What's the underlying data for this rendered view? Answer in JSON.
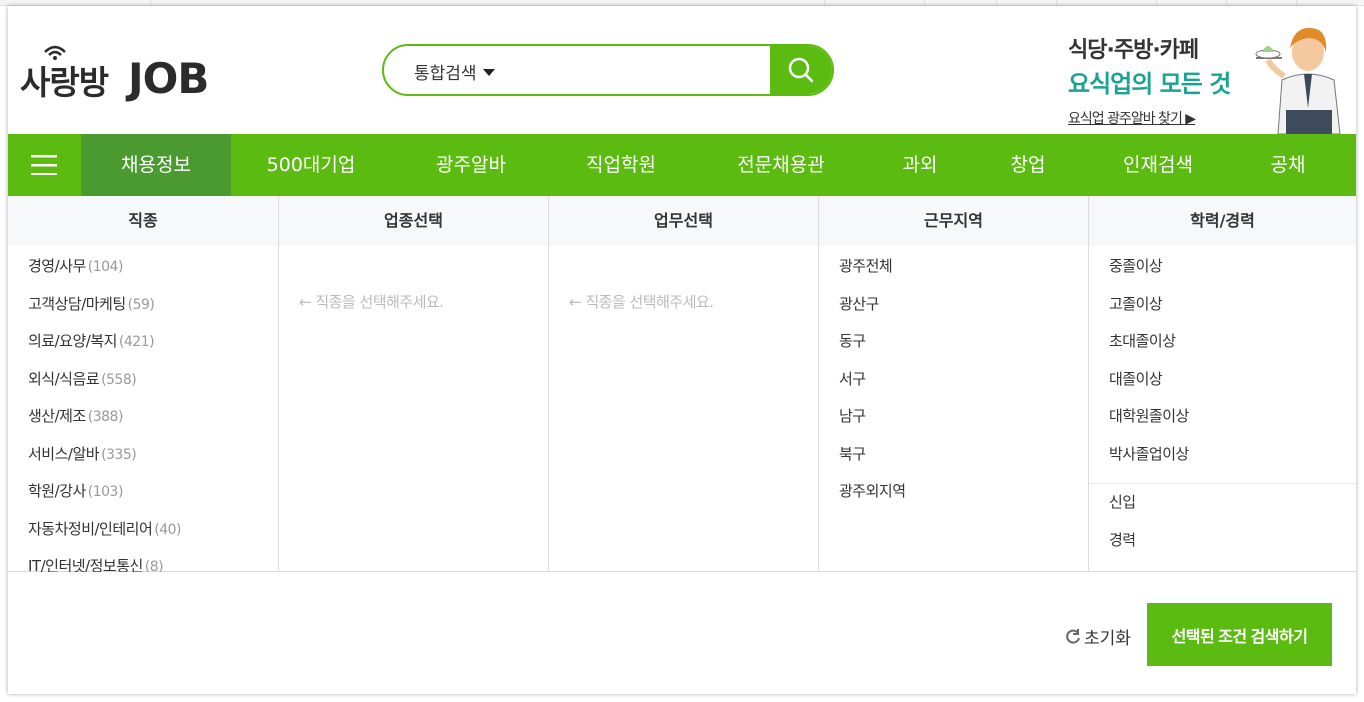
{
  "logo": {
    "text_green": "사랑방",
    "text_dark": "JOB"
  },
  "search": {
    "select_label": "통합검색",
    "placeholder": "",
    "value": ""
  },
  "banner": {
    "line1": "식당·주방·카페",
    "line2": "요식업의 모든 것",
    "line3": "요식업 광주알바 찾기 ▶"
  },
  "nav": {
    "items": [
      {
        "label": "채용정보"
      },
      {
        "label": "500대기업"
      },
      {
        "label": "광주알바"
      },
      {
        "label": "직업학원"
      },
      {
        "label": "전문채용관"
      },
      {
        "label": "과외"
      },
      {
        "label": "창업"
      },
      {
        "label": "인재검색"
      },
      {
        "label": "공채"
      }
    ]
  },
  "columns": {
    "job": {
      "title": "직종",
      "items": [
        {
          "label": "경영/사무",
          "count": "(104)"
        },
        {
          "label": "고객상담/마케팅",
          "count": "(59)"
        },
        {
          "label": "의료/요양/복지",
          "count": "(421)"
        },
        {
          "label": "외식/식음료",
          "count": "(558)"
        },
        {
          "label": "생산/제조",
          "count": "(388)"
        },
        {
          "label": "서비스/알바",
          "count": "(335)"
        },
        {
          "label": "학원/강사",
          "count": "(103)"
        },
        {
          "label": "자동차정비/인테리어",
          "count": "(40)"
        },
        {
          "label": "IT/인터넷/정보통신",
          "count": "(8)"
        }
      ]
    },
    "industry": {
      "title": "업종선택",
      "hint": "← 직종을 선택해주세요."
    },
    "duty": {
      "title": "업무선택",
      "hint": "← 직종을 선택해주세요."
    },
    "region": {
      "title": "근무지역",
      "items": [
        "광주전체",
        "광산구",
        "동구",
        "서구",
        "남구",
        "북구",
        "광주외지역"
      ]
    },
    "edu": {
      "title": "학력/경력",
      "items": [
        "중졸이상",
        "고졸이상",
        "초대졸이상",
        "대졸이상",
        "대학원졸이상",
        "박사졸업이상"
      ],
      "career": [
        "신입",
        "경력"
      ]
    }
  },
  "footer": {
    "reset_label": "초기화",
    "submit_label": "선택된 조건 검색하기"
  },
  "colors": {
    "brand_green": "#5cbb10",
    "nav_active": "#4a9a30",
    "banner_teal": "#1aa392"
  }
}
